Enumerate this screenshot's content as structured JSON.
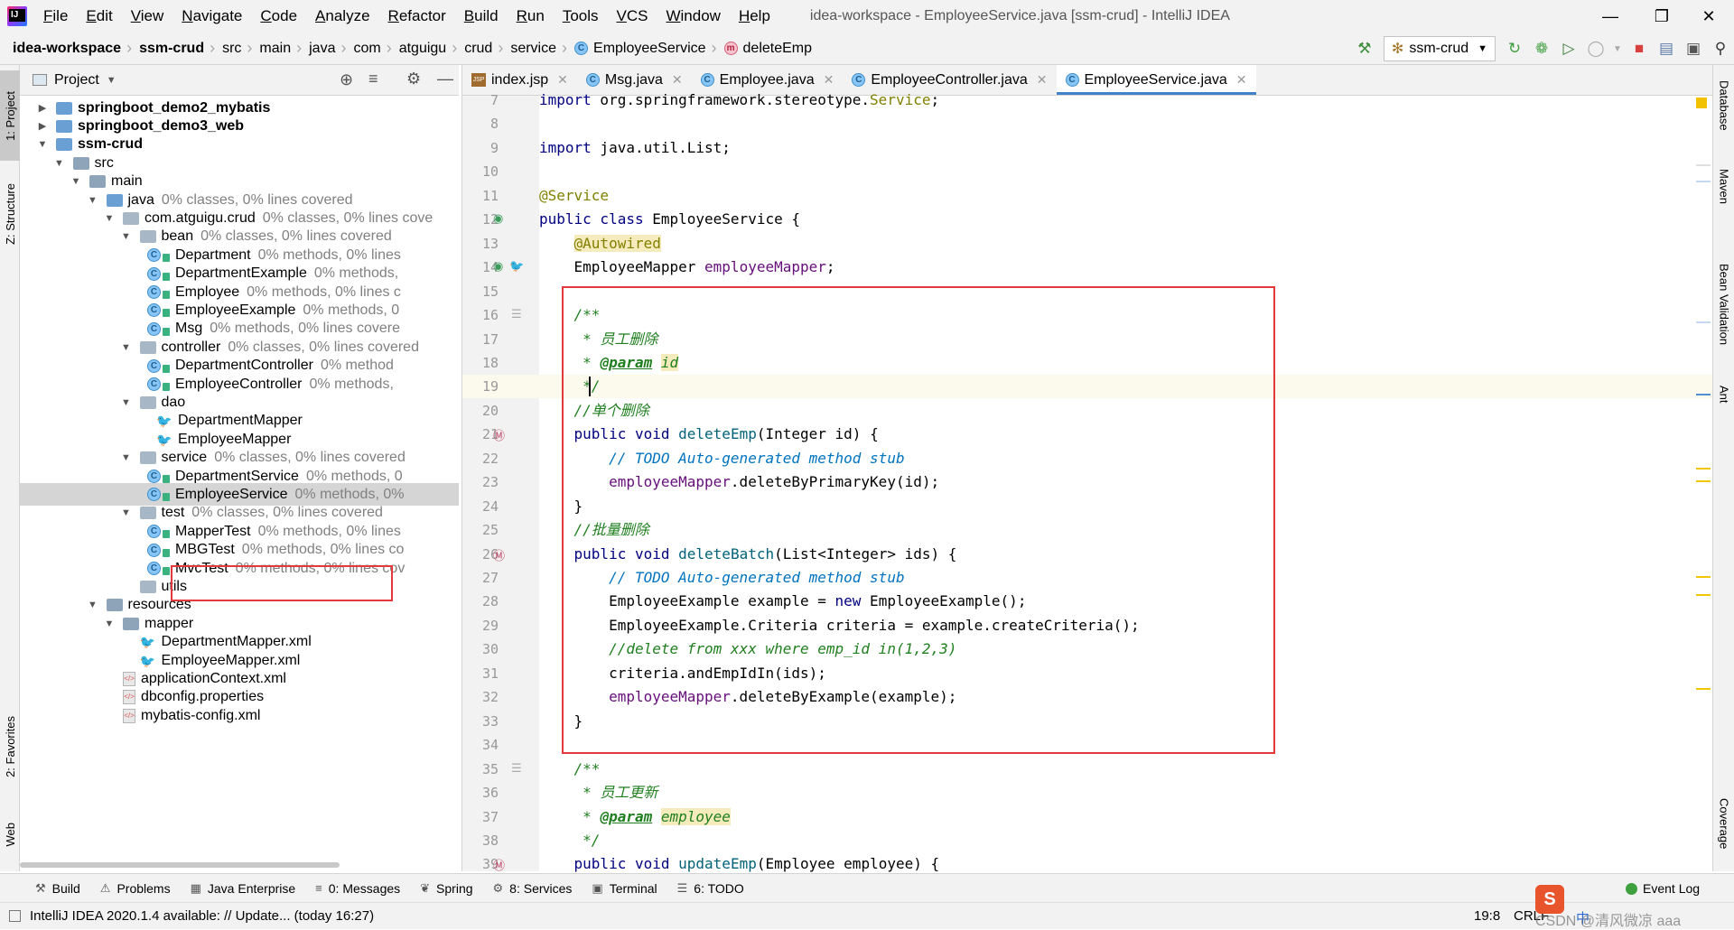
{
  "menu": [
    "File",
    "Edit",
    "View",
    "Navigate",
    "Code",
    "Analyze",
    "Refactor",
    "Build",
    "Run",
    "Tools",
    "VCS",
    "Window",
    "Help"
  ],
  "window_title": "idea-workspace - EmployeeService.java [ssm-crud] - IntelliJ IDEA",
  "breadcrumbs": [
    "idea-workspace",
    "ssm-crud",
    "src",
    "main",
    "java",
    "com",
    "atguigu",
    "crud",
    "service",
    "EmployeeService",
    "deleteEmp"
  ],
  "run_config": "ssm-crud",
  "left_tabs": [
    "1: Project",
    "Z: Structure",
    "2: Favorites",
    "Web"
  ],
  "right_tabs": [
    "Database",
    "Maven",
    "Bean Validation",
    "Ant",
    "Coverage"
  ],
  "project": {
    "header": "Project",
    "tree": [
      {
        "label": "springboot_demo2_mybatis",
        "depth": 0,
        "arrow": "right",
        "icon": "module",
        "bold": true,
        "cov": ""
      },
      {
        "label": "springboot_demo3_web",
        "depth": 0,
        "arrow": "right",
        "icon": "module",
        "bold": true,
        "cov": ""
      },
      {
        "label": "ssm-crud",
        "depth": 0,
        "arrow": "down",
        "icon": "module",
        "bold": true,
        "cov": ""
      },
      {
        "label": "src",
        "depth": 1,
        "arrow": "down",
        "icon": "folder",
        "bold": false,
        "cov": ""
      },
      {
        "label": "main",
        "depth": 2,
        "arrow": "down",
        "icon": "folder",
        "bold": false,
        "cov": ""
      },
      {
        "label": "java",
        "depth": 3,
        "arrow": "down",
        "icon": "blue",
        "bold": false,
        "cov": "0% classes, 0% lines covered"
      },
      {
        "label": "com.atguigu.crud",
        "depth": 4,
        "arrow": "down",
        "icon": "pkg",
        "bold": false,
        "cov": "0% classes, 0% lines cove"
      },
      {
        "label": "bean",
        "depth": 5,
        "arrow": "down",
        "icon": "pkg",
        "bold": false,
        "cov": "0% classes, 0% lines covered"
      },
      {
        "label": "Department",
        "depth": 6,
        "arrow": "",
        "icon": "class",
        "bold": false,
        "cov": "0% methods, 0% lines"
      },
      {
        "label": "DepartmentExample",
        "depth": 6,
        "arrow": "",
        "icon": "class",
        "bold": false,
        "cov": "0% methods,"
      },
      {
        "label": "Employee",
        "depth": 6,
        "arrow": "",
        "icon": "class",
        "bold": false,
        "cov": "0% methods, 0% lines c"
      },
      {
        "label": "EmployeeExample",
        "depth": 6,
        "arrow": "",
        "icon": "class",
        "bold": false,
        "cov": "0% methods, 0"
      },
      {
        "label": "Msg",
        "depth": 6,
        "arrow": "",
        "icon": "class",
        "bold": false,
        "cov": "0% methods, 0% lines covere"
      },
      {
        "label": "controller",
        "depth": 5,
        "arrow": "down",
        "icon": "pkg",
        "bold": false,
        "cov": "0% classes, 0% lines covered"
      },
      {
        "label": "DepartmentController",
        "depth": 6,
        "arrow": "",
        "icon": "class",
        "bold": false,
        "cov": "0% method"
      },
      {
        "label": "EmployeeController",
        "depth": 6,
        "arrow": "",
        "icon": "class",
        "bold": false,
        "cov": "0% methods,"
      },
      {
        "label": "dao",
        "depth": 5,
        "arrow": "down",
        "icon": "pkg",
        "bold": false,
        "cov": ""
      },
      {
        "label": "DepartmentMapper",
        "depth": 6,
        "arrow": "",
        "icon": "bird",
        "bold": false,
        "cov": ""
      },
      {
        "label": "EmployeeMapper",
        "depth": 6,
        "arrow": "",
        "icon": "bird",
        "bold": false,
        "cov": ""
      },
      {
        "label": "service",
        "depth": 5,
        "arrow": "down",
        "icon": "pkg",
        "bold": false,
        "cov": "0% classes, 0% lines covered"
      },
      {
        "label": "DepartmentService",
        "depth": 6,
        "arrow": "",
        "icon": "class",
        "bold": false,
        "cov": "0% methods, 0"
      },
      {
        "label": "EmployeeService",
        "depth": 6,
        "arrow": "",
        "icon": "class",
        "bold": false,
        "cov": "0% methods, 0%",
        "selected": true
      },
      {
        "label": "test",
        "depth": 5,
        "arrow": "down",
        "icon": "pkg",
        "bold": false,
        "cov": "0% classes, 0% lines covered"
      },
      {
        "label": "MapperTest",
        "depth": 6,
        "arrow": "",
        "icon": "class",
        "bold": false,
        "cov": "0% methods, 0% lines"
      },
      {
        "label": "MBGTest",
        "depth": 6,
        "arrow": "",
        "icon": "class",
        "bold": false,
        "cov": "0% methods, 0% lines co"
      },
      {
        "label": "MvcTest",
        "depth": 6,
        "arrow": "",
        "icon": "class",
        "bold": false,
        "cov": "0% methods, 0% lines cov"
      },
      {
        "label": "utils",
        "depth": 5,
        "arrow": "",
        "icon": "pkg",
        "bold": false,
        "cov": ""
      },
      {
        "label": "resources",
        "depth": 3,
        "arrow": "down",
        "icon": "folder",
        "bold": false,
        "cov": ""
      },
      {
        "label": "mapper",
        "depth": 4,
        "arrow": "down",
        "icon": "folder",
        "bold": false,
        "cov": ""
      },
      {
        "label": "DepartmentMapper.xml",
        "depth": 5,
        "arrow": "",
        "icon": "bird",
        "bold": false,
        "cov": ""
      },
      {
        "label": "EmployeeMapper.xml",
        "depth": 5,
        "arrow": "",
        "icon": "bird",
        "bold": false,
        "cov": ""
      },
      {
        "label": "applicationContext.xml",
        "depth": 4,
        "arrow": "",
        "icon": "xml",
        "bold": false,
        "cov": ""
      },
      {
        "label": "dbconfig.properties",
        "depth": 4,
        "arrow": "",
        "icon": "xml",
        "bold": false,
        "cov": ""
      },
      {
        "label": "mybatis-config.xml",
        "depth": 4,
        "arrow": "",
        "icon": "xml",
        "bold": false,
        "cov": ""
      }
    ]
  },
  "tabs": [
    {
      "label": "index.jsp",
      "icon": "jsp",
      "active": false
    },
    {
      "label": "Msg.java",
      "icon": "class",
      "active": false
    },
    {
      "label": "Employee.java",
      "icon": "class",
      "active": false
    },
    {
      "label": "EmployeeController.java",
      "icon": "class",
      "active": false
    },
    {
      "label": "EmployeeService.java",
      "icon": "class",
      "active": true
    }
  ],
  "code_lines": [
    {
      "n": "7",
      "html": "<span class='kw'>import</span> org.springframework.stereotype.<span class='ann'>Service</span>;"
    },
    {
      "n": "8",
      "html": ""
    },
    {
      "n": "9",
      "html": "<span class='kw'>import</span> java.util.List;"
    },
    {
      "n": "10",
      "html": ""
    },
    {
      "n": "11",
      "html": "<span class='ann'>@Service</span>"
    },
    {
      "n": "12",
      "html": "<span class='kw'>public class</span> EmployeeService {"
    },
    {
      "n": "13",
      "html": "    <span class='ann hl'>@Autowired</span>"
    },
    {
      "n": "14",
      "html": "    EmployeeMapper <span class='fld'>employeeMapper</span>;"
    },
    {
      "n": "15",
      "html": ""
    },
    {
      "n": "16",
      "html": "    <span class='doc'>/**</span>"
    },
    {
      "n": "17",
      "html": "<span class='doc'>     * 员工删除</span>"
    },
    {
      "n": "18",
      "html": "<span class='doc'>     * </span><span class='tag'>@param</span><span class='doc'> </span><span class='doc hl'>id</span>"
    },
    {
      "n": "19",
      "html": "<span class='doc'>     */</span>"
    },
    {
      "n": "20",
      "html": "    <span class='doc'>//单个删除</span>"
    },
    {
      "n": "21",
      "html": "    <span class='kw'>public void</span> <span class='mth'>deleteEmp</span>(Integer id) {"
    },
    {
      "n": "22",
      "html": "        <span class='todo'>// TODO Auto-generated method stub</span>"
    },
    {
      "n": "23",
      "html": "        <span class='fld'>employeeMapper</span>.deleteByPrimaryKey(id);"
    },
    {
      "n": "24",
      "html": "    }"
    },
    {
      "n": "25",
      "html": "    <span class='doc'>//批量删除</span>"
    },
    {
      "n": "26",
      "html": "    <span class='kw'>public void</span> <span class='mth'>deleteBatch</span>(List&lt;Integer&gt; ids) {"
    },
    {
      "n": "27",
      "html": "        <span class='todo'>// TODO Auto-generated method stub</span>"
    },
    {
      "n": "28",
      "html": "        EmployeeExample example = <span class='kw'>new</span> EmployeeExample();"
    },
    {
      "n": "29",
      "html": "        EmployeeExample.Criteria criteria = example.createCriteria();"
    },
    {
      "n": "30",
      "html": "        <span class='doc'>//delete from xxx where emp_id in(1,2,3)</span>"
    },
    {
      "n": "31",
      "html": "        criteria.andEmpIdIn(ids);"
    },
    {
      "n": "32",
      "html": "        <span class='fld'>employeeMapper</span>.deleteByExample(example);"
    },
    {
      "n": "33",
      "html": "    }"
    },
    {
      "n": "34",
      "html": ""
    },
    {
      "n": "35",
      "html": "    <span class='doc'>/**</span>"
    },
    {
      "n": "36",
      "html": "<span class='doc'>     * 员工更新</span>"
    },
    {
      "n": "37",
      "html": "<span class='doc'>     * </span><span class='tag'>@param</span><span class='doc'> </span><span class='doc hl'>employee</span>"
    },
    {
      "n": "38",
      "html": "<span class='doc'>     */</span>"
    },
    {
      "n": "39",
      "html": "    <span class='kw'>public void</span> <span class='mth'>updateEmp</span>(Employee employee) {"
    }
  ],
  "bottom_tools": [
    {
      "label": "Build",
      "icon": "hammer-icon"
    },
    {
      "label": "Problems",
      "icon": "warning-icon"
    },
    {
      "label": "Java Enterprise",
      "icon": "enterprise-icon"
    },
    {
      "label": "0: Messages",
      "icon": "messages-icon"
    },
    {
      "label": "Spring",
      "icon": "spring-icon"
    },
    {
      "label": "8: Services",
      "icon": "services-icon"
    },
    {
      "label": "Terminal",
      "icon": "terminal-icon"
    },
    {
      "label": "6: TODO",
      "icon": "todo-icon"
    }
  ],
  "event_log": "Event Log",
  "status": {
    "message": "IntelliJ IDEA 2020.1.4 available: // Update... (today 16:27)",
    "position": "19:8",
    "line_sep": "CRLF",
    "watermark": "CSDN @清风微凉 aaa",
    "ime": "中"
  }
}
